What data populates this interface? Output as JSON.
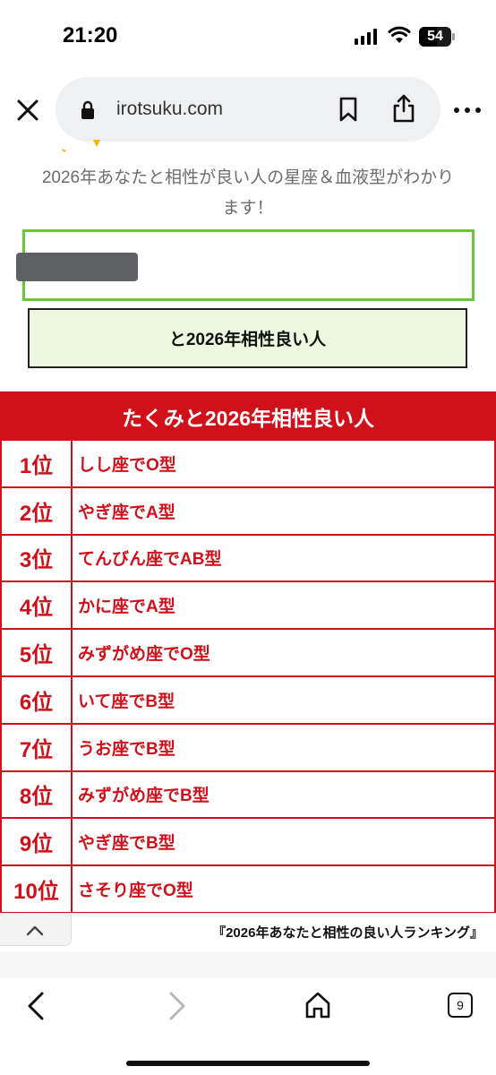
{
  "status_bar": {
    "time": "21:20",
    "battery_level": "54"
  },
  "browser": {
    "url": "irotsuku.com",
    "open_tabs_count": "9"
  },
  "page": {
    "subtitle_line1": "2026年あなたと相性が良い人の星座＆血液型がわかり",
    "subtitle_line2": "ます！",
    "submit_label": "と2026年相性良い人",
    "ranking_title": "たくみと2026年相性良い人",
    "ranking": [
      {
        "rank": "1位",
        "text": "しし座でO型"
      },
      {
        "rank": "2位",
        "text": "やぎ座でA型"
      },
      {
        "rank": "3位",
        "text": "てんびん座でAB型"
      },
      {
        "rank": "4位",
        "text": "かに座でA型"
      },
      {
        "rank": "5位",
        "text": "みずがめ座でO型"
      },
      {
        "rank": "6位",
        "text": "いて座でB型"
      },
      {
        "rank": "7位",
        "text": "うお座でB型"
      },
      {
        "rank": "8位",
        "text": "みずがめ座でB型"
      },
      {
        "rank": "9位",
        "text": "やぎ座でB型"
      },
      {
        "rank": "10位",
        "text": "さそり座でO型"
      }
    ],
    "footer_title": "『2026年あなたと相性の良い人ランキング』"
  },
  "colors": {
    "accent_red": "#d0101a",
    "input_border_green": "#6ac73a",
    "button_bg": "#eef8e0"
  }
}
